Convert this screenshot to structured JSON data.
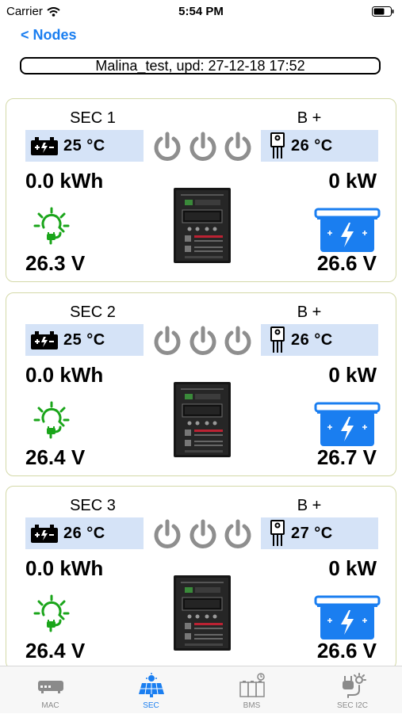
{
  "status_bar": {
    "carrier": "Carrier",
    "time": "5:54 PM"
  },
  "nav": {
    "back_label": "< Nodes"
  },
  "header": {
    "update_text": "Malina_test, upd: 27-12-18 17:52"
  },
  "colors": {
    "accent": "#1a7ef0",
    "solar_green": "#1aa51a",
    "battery_blue": "#1a7ef0",
    "temp_box_bg": "#d5e3f7",
    "power_icon_gray": "#8e8e8e"
  },
  "nodes": [
    {
      "title": "SEC 1",
      "sensor_label": "B +",
      "temp_left": "25 °C",
      "temp_right": "26 °C",
      "energy": "0.0 kWh",
      "power": "0 kW",
      "solar_voltage": "26.3 V",
      "battery_voltage": "26.6 V"
    },
    {
      "title": "SEC 2",
      "sensor_label": "B +",
      "temp_left": "25 °C",
      "temp_right": "26 °C",
      "energy": "0.0 kWh",
      "power": "0 kW",
      "solar_voltage": "26.4 V",
      "battery_voltage": "26.7 V"
    },
    {
      "title": "SEC 3",
      "sensor_label": "B +",
      "temp_left": "26 °C",
      "temp_right": "27 °C",
      "energy": "0.0 kWh",
      "power": "0 kW",
      "solar_voltage": "26.4 V",
      "battery_voltage": "26.6 V"
    }
  ],
  "tabs": [
    {
      "label": "MAC",
      "icon": "router-icon",
      "active": false
    },
    {
      "label": "SEC",
      "icon": "solar-panel-icon",
      "active": true
    },
    {
      "label": "BMS",
      "icon": "battery-pack-icon",
      "active": false
    },
    {
      "label": "SEC I2C",
      "icon": "plug-sun-icon",
      "active": false
    }
  ]
}
